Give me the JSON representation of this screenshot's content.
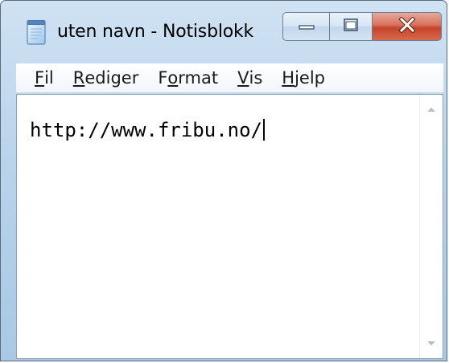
{
  "window": {
    "title": "uten navn - Notisblokk",
    "colors": {
      "frame": "#b9d3ea",
      "close_button": "#c4442a",
      "menubar": "#f1f5fb",
      "editor_background": "#ffffff"
    }
  },
  "caption_buttons": {
    "minimize_icon": "minimize-icon",
    "maximize_icon": "maximize-icon",
    "close_icon": "close-icon"
  },
  "menu": {
    "items": [
      {
        "label_accel": "F",
        "label_rest": "il"
      },
      {
        "label_accel": "R",
        "label_rest": "ediger"
      },
      {
        "label_pre": "F",
        "label_accel": "o",
        "label_rest": "rmat"
      },
      {
        "label_accel": "V",
        "label_rest": "is"
      },
      {
        "label_accel": "H",
        "label_rest": "jelp"
      }
    ]
  },
  "editor": {
    "content": "http://www.fribu.no/"
  }
}
